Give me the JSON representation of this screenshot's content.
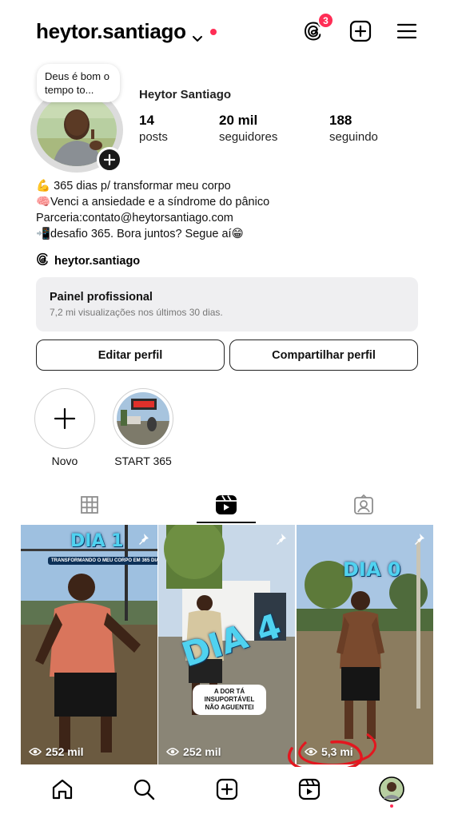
{
  "header": {
    "username": "heytor.santiago",
    "threads_badge_count": "3",
    "icons": [
      "chevron-down-icon",
      "threads-icon",
      "add-post-icon",
      "menu-icon"
    ],
    "accent_color": "#ff2d55"
  },
  "profile": {
    "note": "Deus é bom o tempo to...",
    "name": "Heytor Santiago",
    "stats": [
      {
        "value": "14",
        "label": "posts"
      },
      {
        "value": "20 mil",
        "label": "seguidores"
      },
      {
        "value": "188",
        "label": "seguindo"
      }
    ],
    "bio": [
      "💪 365 dias p/ transformar meu corpo",
      "🧠Venci a ansiedade e a síndrome do pânico",
      "Parceria:contato@heytorsantiago.com",
      "📲desafio 365. Bora juntos? Segue aí😁"
    ],
    "threads_handle": "heytor.santiago"
  },
  "dashboard": {
    "title": "Painel profissional",
    "subtitle": "7,2 mi visualizações nos últimos 30 dias."
  },
  "actions": {
    "edit": "Editar perfil",
    "share": "Compartilhar perfil"
  },
  "highlights": [
    {
      "label": "Novo"
    },
    {
      "label": "START 365"
    }
  ],
  "tabs": {
    "items": [
      "grid-icon",
      "reels-icon",
      "tagged-icon"
    ],
    "active": "reels"
  },
  "reels": [
    {
      "overlay": "DIA 1",
      "caption": "TRANSFORMANDO O MEU CORPO EM 365 DIAS",
      "views": "252 mil",
      "pinned": true
    },
    {
      "overlay": "DIA 4",
      "caption": "A DOR TÁ INSUPORTÁVEL NÃO AGUENTEI",
      "views": "252 mil",
      "pinned": true
    },
    {
      "overlay": "DIA 0",
      "caption": "",
      "views": "5,3 mi",
      "pinned": true
    }
  ],
  "bottom_nav": {
    "items": [
      "home-icon",
      "search-icon",
      "create-icon",
      "reels-icon",
      "profile-avatar"
    ]
  }
}
